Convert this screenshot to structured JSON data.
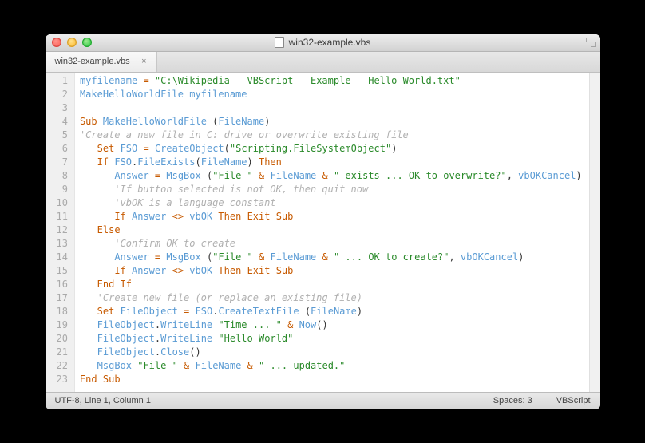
{
  "window": {
    "title": "win32-example.vbs"
  },
  "tab": {
    "label": "win32-example.vbs",
    "close": "×"
  },
  "code": {
    "lines": [
      [
        [
          "id",
          "myfilename"
        ],
        [
          "txt",
          " "
        ],
        [
          "op",
          "="
        ],
        [
          "txt",
          " "
        ],
        [
          "str",
          "\"C:\\Wikipedia - VBScript - Example - Hello World.txt\""
        ]
      ],
      [
        [
          "id",
          "MakeHelloWorldFile"
        ],
        [
          "txt",
          " "
        ],
        [
          "id",
          "myfilename"
        ]
      ],
      [
        [
          "txt",
          ""
        ]
      ],
      [
        [
          "kw",
          "Sub"
        ],
        [
          "txt",
          " "
        ],
        [
          "id",
          "MakeHelloWorldFile"
        ],
        [
          "txt",
          " ("
        ],
        [
          "id",
          "FileName"
        ],
        [
          "txt",
          ")"
        ]
      ],
      [
        [
          "cmt",
          "'Create a new file in C: drive or overwrite existing file"
        ]
      ],
      [
        [
          "txt",
          "   "
        ],
        [
          "kw",
          "Set"
        ],
        [
          "txt",
          " "
        ],
        [
          "id",
          "FSO"
        ],
        [
          "txt",
          " "
        ],
        [
          "op",
          "="
        ],
        [
          "txt",
          " "
        ],
        [
          "id",
          "CreateObject"
        ],
        [
          "txt",
          "("
        ],
        [
          "str",
          "\"Scripting.FileSystemObject\""
        ],
        [
          "txt",
          ")"
        ]
      ],
      [
        [
          "txt",
          "   "
        ],
        [
          "kw",
          "If"
        ],
        [
          "txt",
          " "
        ],
        [
          "id",
          "FSO"
        ],
        [
          "txt",
          "."
        ],
        [
          "id",
          "FileExists"
        ],
        [
          "txt",
          "("
        ],
        [
          "id",
          "FileName"
        ],
        [
          "txt",
          ") "
        ],
        [
          "kw",
          "Then"
        ]
      ],
      [
        [
          "txt",
          "      "
        ],
        [
          "id",
          "Answer"
        ],
        [
          "txt",
          " "
        ],
        [
          "op",
          "="
        ],
        [
          "txt",
          " "
        ],
        [
          "id",
          "MsgBox"
        ],
        [
          "txt",
          " ("
        ],
        [
          "str",
          "\"File \""
        ],
        [
          "txt",
          " "
        ],
        [
          "op",
          "&"
        ],
        [
          "txt",
          " "
        ],
        [
          "id",
          "FileName"
        ],
        [
          "txt",
          " "
        ],
        [
          "op",
          "&"
        ],
        [
          "txt",
          " "
        ],
        [
          "str",
          "\" exists ... OK to overwrite?\""
        ],
        [
          "txt",
          ", "
        ],
        [
          "id",
          "vbOKCancel"
        ],
        [
          "txt",
          ")"
        ]
      ],
      [
        [
          "txt",
          "      "
        ],
        [
          "cmt",
          "'If button selected is not OK, then quit now"
        ]
      ],
      [
        [
          "txt",
          "      "
        ],
        [
          "cmt",
          "'vbOK is a language constant"
        ]
      ],
      [
        [
          "txt",
          "      "
        ],
        [
          "kw",
          "If"
        ],
        [
          "txt",
          " "
        ],
        [
          "id",
          "Answer"
        ],
        [
          "txt",
          " "
        ],
        [
          "op",
          "<>"
        ],
        [
          "txt",
          " "
        ],
        [
          "id",
          "vbOK"
        ],
        [
          "txt",
          " "
        ],
        [
          "kw",
          "Then"
        ],
        [
          "txt",
          " "
        ],
        [
          "kw",
          "Exit"
        ],
        [
          "txt",
          " "
        ],
        [
          "kw",
          "Sub"
        ]
      ],
      [
        [
          "txt",
          "   "
        ],
        [
          "kw",
          "Else"
        ]
      ],
      [
        [
          "txt",
          "      "
        ],
        [
          "cmt",
          "'Confirm OK to create"
        ]
      ],
      [
        [
          "txt",
          "      "
        ],
        [
          "id",
          "Answer"
        ],
        [
          "txt",
          " "
        ],
        [
          "op",
          "="
        ],
        [
          "txt",
          " "
        ],
        [
          "id",
          "MsgBox"
        ],
        [
          "txt",
          " ("
        ],
        [
          "str",
          "\"File \""
        ],
        [
          "txt",
          " "
        ],
        [
          "op",
          "&"
        ],
        [
          "txt",
          " "
        ],
        [
          "id",
          "FileName"
        ],
        [
          "txt",
          " "
        ],
        [
          "op",
          "&"
        ],
        [
          "txt",
          " "
        ],
        [
          "str",
          "\" ... OK to create?\""
        ],
        [
          "txt",
          ", "
        ],
        [
          "id",
          "vbOKCancel"
        ],
        [
          "txt",
          ")"
        ]
      ],
      [
        [
          "txt",
          "      "
        ],
        [
          "kw",
          "If"
        ],
        [
          "txt",
          " "
        ],
        [
          "id",
          "Answer"
        ],
        [
          "txt",
          " "
        ],
        [
          "op",
          "<>"
        ],
        [
          "txt",
          " "
        ],
        [
          "id",
          "vbOK"
        ],
        [
          "txt",
          " "
        ],
        [
          "kw",
          "Then"
        ],
        [
          "txt",
          " "
        ],
        [
          "kw",
          "Exit"
        ],
        [
          "txt",
          " "
        ],
        [
          "kw",
          "Sub"
        ]
      ],
      [
        [
          "txt",
          "   "
        ],
        [
          "kw",
          "End"
        ],
        [
          "txt",
          " "
        ],
        [
          "kw",
          "If"
        ]
      ],
      [
        [
          "txt",
          "   "
        ],
        [
          "cmt",
          "'Create new file (or replace an existing file)"
        ]
      ],
      [
        [
          "txt",
          "   "
        ],
        [
          "kw",
          "Set"
        ],
        [
          "txt",
          " "
        ],
        [
          "id",
          "FileObject"
        ],
        [
          "txt",
          " "
        ],
        [
          "op",
          "="
        ],
        [
          "txt",
          " "
        ],
        [
          "id",
          "FSO"
        ],
        [
          "txt",
          "."
        ],
        [
          "id",
          "CreateTextFile"
        ],
        [
          "txt",
          " ("
        ],
        [
          "id",
          "FileName"
        ],
        [
          "txt",
          ")"
        ]
      ],
      [
        [
          "txt",
          "   "
        ],
        [
          "id",
          "FileObject"
        ],
        [
          "txt",
          "."
        ],
        [
          "id",
          "WriteLine"
        ],
        [
          "txt",
          " "
        ],
        [
          "str",
          "\"Time ... \""
        ],
        [
          "txt",
          " "
        ],
        [
          "op",
          "&"
        ],
        [
          "txt",
          " "
        ],
        [
          "id",
          "Now"
        ],
        [
          "txt",
          "()"
        ]
      ],
      [
        [
          "txt",
          "   "
        ],
        [
          "id",
          "FileObject"
        ],
        [
          "txt",
          "."
        ],
        [
          "id",
          "WriteLine"
        ],
        [
          "txt",
          " "
        ],
        [
          "str",
          "\"Hello World\""
        ]
      ],
      [
        [
          "txt",
          "   "
        ],
        [
          "id",
          "FileObject"
        ],
        [
          "txt",
          "."
        ],
        [
          "id",
          "Close"
        ],
        [
          "txt",
          "()"
        ]
      ],
      [
        [
          "txt",
          "   "
        ],
        [
          "id",
          "MsgBox"
        ],
        [
          "txt",
          " "
        ],
        [
          "str",
          "\"File \""
        ],
        [
          "txt",
          " "
        ],
        [
          "op",
          "&"
        ],
        [
          "txt",
          " "
        ],
        [
          "id",
          "FileName"
        ],
        [
          "txt",
          " "
        ],
        [
          "op",
          "&"
        ],
        [
          "txt",
          " "
        ],
        [
          "str",
          "\" ... updated.\""
        ]
      ],
      [
        [
          "kw",
          "End"
        ],
        [
          "txt",
          " "
        ],
        [
          "kw",
          "Sub"
        ]
      ]
    ]
  },
  "status": {
    "left": "UTF-8, Line 1, Column 1",
    "spaces": "Spaces: 3",
    "lang": "VBScript"
  }
}
